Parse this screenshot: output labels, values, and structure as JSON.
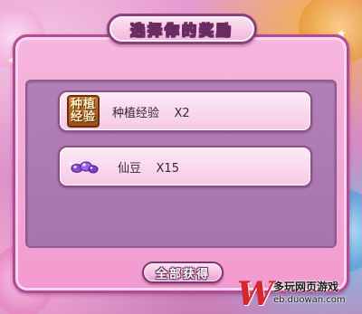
{
  "dialog": {
    "title": "选择你的奖励",
    "rewards": [
      {
        "icon": "planting-exp-icon",
        "icon_text": [
          "种植",
          "经验"
        ],
        "label": "种植经验    X2"
      },
      {
        "icon": "fairy-bean-icon",
        "label": "仙豆    X15"
      }
    ],
    "claim_all_label": "全部获得"
  },
  "watermark": {
    "brand_letter": "W",
    "title": "多玩网页游戏",
    "url": "eb.duowan.com"
  },
  "colors": {
    "frame_border": "#b34a93",
    "panel": "#a874ad",
    "row_bg": "#fdeaf6",
    "title_outline": "#6a2a62",
    "watermark_red": "#d9262c"
  }
}
